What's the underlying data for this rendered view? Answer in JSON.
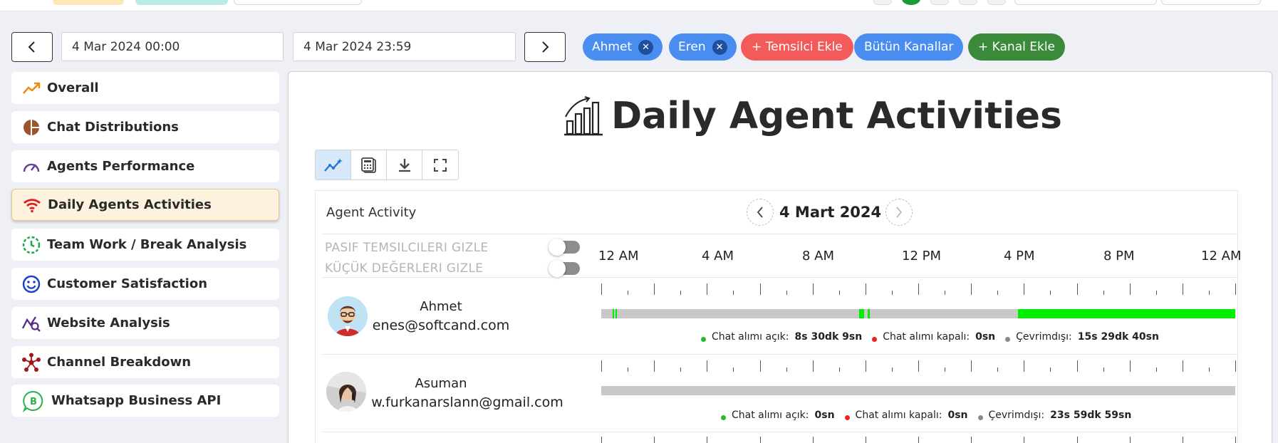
{
  "date_range": {
    "start": "4 Mar 2024 00:00",
    "end": "4 Mar 2024 23:59"
  },
  "filters": {
    "agents": [
      "Ahmet",
      "Eren"
    ],
    "add_agent": "+ Temsilci Ekle",
    "all_channels": "Bütün Kanallar",
    "add_channel": "+ Kanal Ekle"
  },
  "colors": {
    "agent_chip": "#4a8df0",
    "add_agent": "#f35a5a",
    "all_channels": "#4a8df0",
    "add_channel": "#3a8a3a",
    "online": "#00ee00",
    "closed": "#ee2222",
    "offline": "#888888"
  },
  "sidebar": {
    "items": [
      {
        "label": "Overall",
        "icon": "trending-up-icon"
      },
      {
        "label": "Chat Distributions",
        "icon": "pie-chart-icon"
      },
      {
        "label": "Agents Performance",
        "icon": "gauge-icon"
      },
      {
        "label": "Daily Agents Activities",
        "icon": "wifi-icon"
      },
      {
        "label": "Team Work / Break Analysis",
        "icon": "clock-icon"
      },
      {
        "label": "Customer Satisfaction",
        "icon": "smile-icon"
      },
      {
        "label": "Website Analysis",
        "icon": "analytics-search-icon"
      },
      {
        "label": "Channel Breakdown",
        "icon": "network-icon"
      },
      {
        "label": "Whatsapp Business API",
        "icon": "whatsapp-icon"
      }
    ],
    "active_index": 3
  },
  "main": {
    "title": "Daily Agent Activities",
    "activity_label": "Agent Activity",
    "current_date": "4 Mart 2024",
    "options": {
      "hide_passive": "PASIF TEMSILCILERI GIZLE",
      "hide_small": "KÜÇÜK DEĞERLERI GIZLE"
    },
    "hours": [
      "12 AM",
      "4 AM",
      "8 AM",
      "12 PM",
      "4 PM",
      "8 PM",
      "12 AM"
    ]
  },
  "agents": [
    {
      "name": "Ahmet",
      "email": "enes@softcand.com",
      "legend": {
        "open_label": "Chat alımı açık:",
        "open_value": "8s 30dk 9sn",
        "closed_label": "Chat alımı kapalı:",
        "closed_value": "0sn",
        "offline_label": "Çevrimdışı:",
        "offline_value": "15s 29dk 40sn"
      }
    },
    {
      "name": "Asuman",
      "email": "w.furkanarslann@gmail.com",
      "legend": {
        "open_label": "Chat alımı açık:",
        "open_value": "0sn",
        "closed_label": "Chat alımı kapalı:",
        "closed_value": "0sn",
        "offline_label": "Çevrimdışı:",
        "offline_value": "23s 59dk 59sn"
      }
    }
  ]
}
